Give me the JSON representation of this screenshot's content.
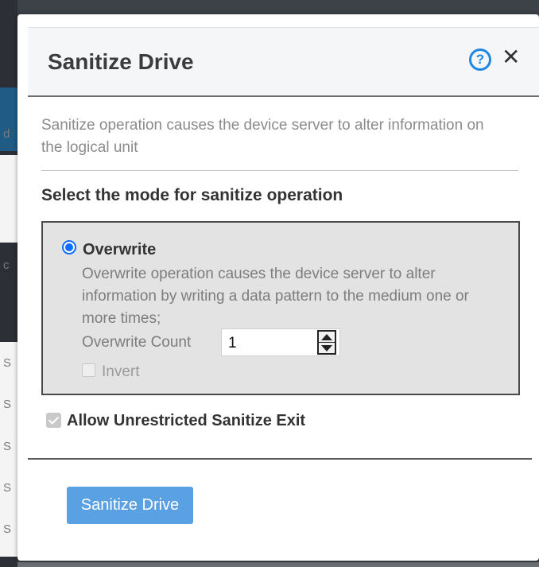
{
  "dialog": {
    "title": "Sanitize Drive",
    "description": "Sanitize operation causes the device server to alter information on the logical unit",
    "section_title": "Select the mode for sanitize operation",
    "mode": {
      "label": "Overwrite",
      "selected": true,
      "description": "Overwrite operation causes the device server to alter information by writing a data pattern to the medium one or more times;",
      "count_label": "Overwrite Count",
      "count_value": "1",
      "invert_label": "Invert",
      "invert_checked": false
    },
    "unrestricted_label": "Allow Unrestricted Sanitize Exit",
    "unrestricted_checked": true,
    "primary_button_label": "Sanitize Drive"
  },
  "icons": {
    "help": "help-icon",
    "close": "close-icon"
  },
  "colors": {
    "accent": "#1e88e5",
    "button": "#5aa1e3",
    "mode_box_bg": "#e3e3e3"
  }
}
